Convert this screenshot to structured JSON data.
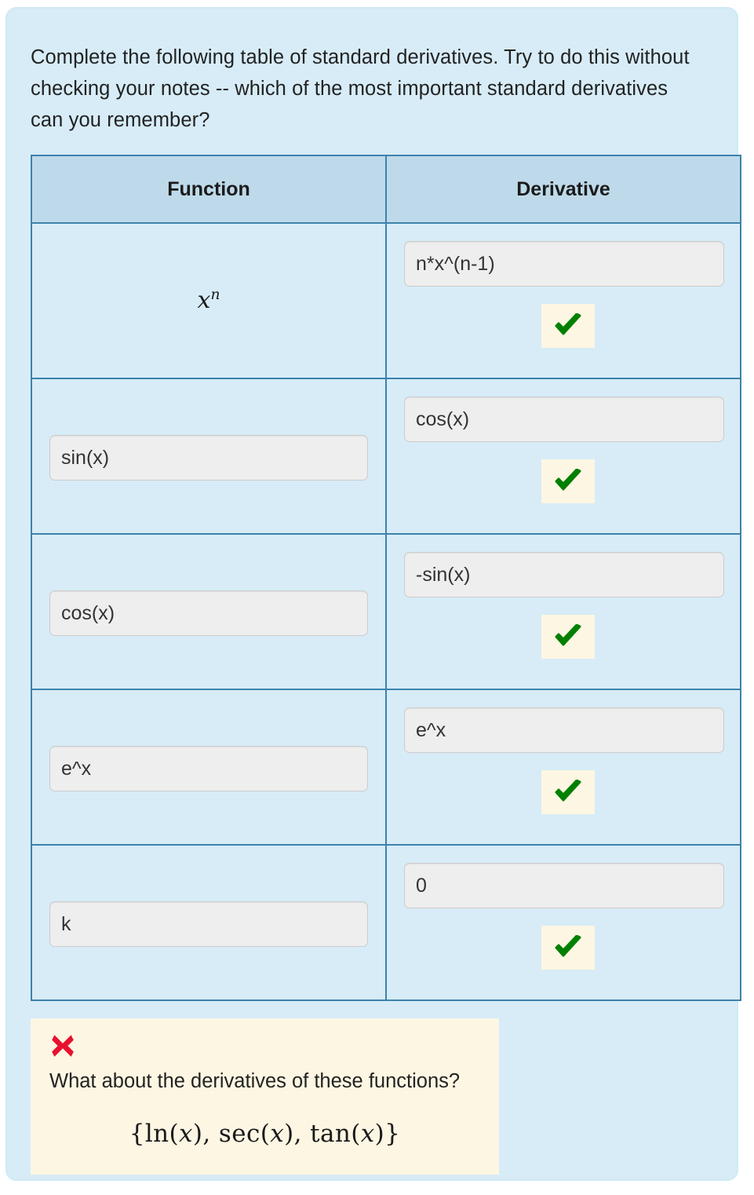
{
  "prompt": "Complete the following table of standard derivatives. Try to do this without checking your notes -- which of the most important standard derivatives can you remember?",
  "table": {
    "headers": {
      "function": "Function",
      "derivative": "Derivative"
    },
    "rows": [
      {
        "function_display": "x",
        "function_exponent": "n",
        "function_is_math": true,
        "function_value": "",
        "derivative_value": "n*x^(n-1)",
        "derivative_status": "correct",
        "status_icon": "check-icon"
      },
      {
        "function_display": "",
        "function_exponent": "",
        "function_is_math": false,
        "function_value": "sin(x)",
        "derivative_value": "cos(x)",
        "derivative_status": "correct",
        "status_icon": "check-icon"
      },
      {
        "function_display": "",
        "function_exponent": "",
        "function_is_math": false,
        "function_value": "cos(x)",
        "derivative_value": "-sin(x)",
        "derivative_status": "correct",
        "status_icon": "check-icon"
      },
      {
        "function_display": "",
        "function_exponent": "",
        "function_is_math": false,
        "function_value": "e^x",
        "derivative_value": "e^x",
        "derivative_status": "correct",
        "status_icon": "check-icon"
      },
      {
        "function_display": "",
        "function_exponent": "",
        "function_is_math": false,
        "function_value": "k",
        "derivative_value": "0",
        "derivative_status": "correct",
        "status_icon": "check-icon"
      }
    ]
  },
  "feedback": {
    "status_icon": "cross-icon",
    "status": "incorrect",
    "text": "What about the derivatives of these functions?",
    "math": {
      "open_brace": "{",
      "items": [
        {
          "fn": "ln",
          "open": "(",
          "var": "x",
          "close": ")",
          "sep": ", "
        },
        {
          "fn": "sec",
          "open": "(",
          "var": "x",
          "close": ")",
          "sep": ", "
        },
        {
          "fn": "tan",
          "open": "(",
          "var": "x",
          "close": ")",
          "sep": ""
        }
      ],
      "close_brace": "}",
      "plain": "{ln(x), sec(x), tan(x)}"
    }
  },
  "colors": {
    "panel_background": "#d7ecf7",
    "panel_border": "#cfe9f5",
    "table_border": "#3d82ac",
    "header_background": "#bedaea",
    "row_background": "#d7ecf7",
    "input_background": "#eeeeee",
    "input_border": "#cccccc",
    "correct_badge_background": "#fdf6e3",
    "correct_check": "#008000",
    "incorrect_cross": "#e8112d",
    "text": "#222222"
  }
}
